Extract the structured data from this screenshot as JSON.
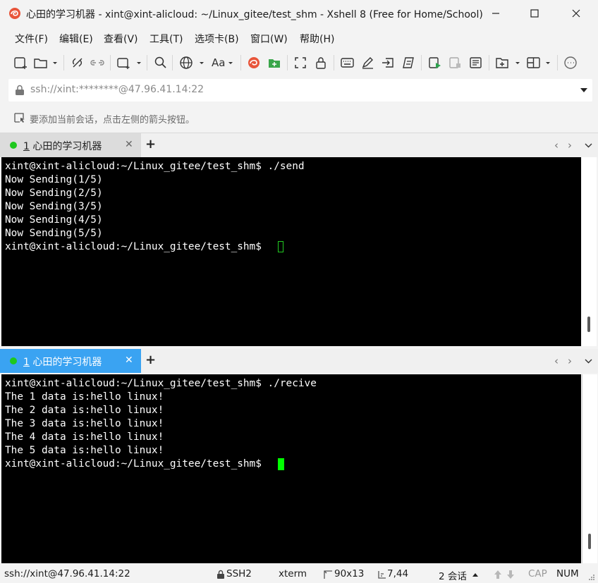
{
  "window": {
    "title": "心田的学习机器 - xint@xint-alicloud: ~/Linux_gitee/test_shm - Xshell 8 (Free for Home/School)",
    "controls": {
      "minimize": "─",
      "maximize": "☐",
      "close": "✕"
    }
  },
  "menu": {
    "items": [
      "文件(F)",
      "编辑(E)",
      "查看(V)",
      "工具(T)",
      "选项卡(B)",
      "窗口(W)",
      "帮助(H)"
    ]
  },
  "toolbar": {
    "font_label": "Aa"
  },
  "address": {
    "value": "ssh://xint:********@47.96.41.14:22"
  },
  "hint": {
    "text": "要添加当前会话，点击左侧的箭头按钮。"
  },
  "panes": [
    {
      "tab": {
        "number": "1",
        "label": "心田的学习机器",
        "close": "✕",
        "add": "+"
      },
      "lines": [
        "xint@xint-alicloud:~/Linux_gitee/test_shm$ ./send",
        "Now Sending(1/5)",
        "Now Sending(2/5)",
        "Now Sending(3/5)",
        "Now Sending(4/5)",
        "Now Sending(5/5)",
        "xint@xint-alicloud:~/Linux_gitee/test_shm$ "
      ]
    },
    {
      "tab": {
        "number": "1",
        "label": "心田的学习机器",
        "close": "✕",
        "add": "+"
      },
      "lines": [
        "xint@xint-alicloud:~/Linux_gitee/test_shm$ ./recive",
        "The 1 data is:hello linux!",
        "The 2 data is:hello linux!",
        "The 3 data is:hello linux!",
        "The 4 data is:hello linux!",
        "The 5 data is:hello linux!",
        "xint@xint-alicloud:~/Linux_gitee/test_shm$ "
      ]
    }
  ],
  "status": {
    "connection": "ssh://xint@47.96.41.14:22",
    "protocol": "SSH2",
    "terminal": "xterm",
    "size": "90x13",
    "cursor": "7,44",
    "sessions": "2 会话",
    "cap": "CAP",
    "num": "NUM"
  },
  "colors": {
    "active_tab": "#3aa3f2",
    "session_dot": "#1ec81e",
    "cursor_active": "#00ff00",
    "cursor_inactive": "#22cc22"
  }
}
